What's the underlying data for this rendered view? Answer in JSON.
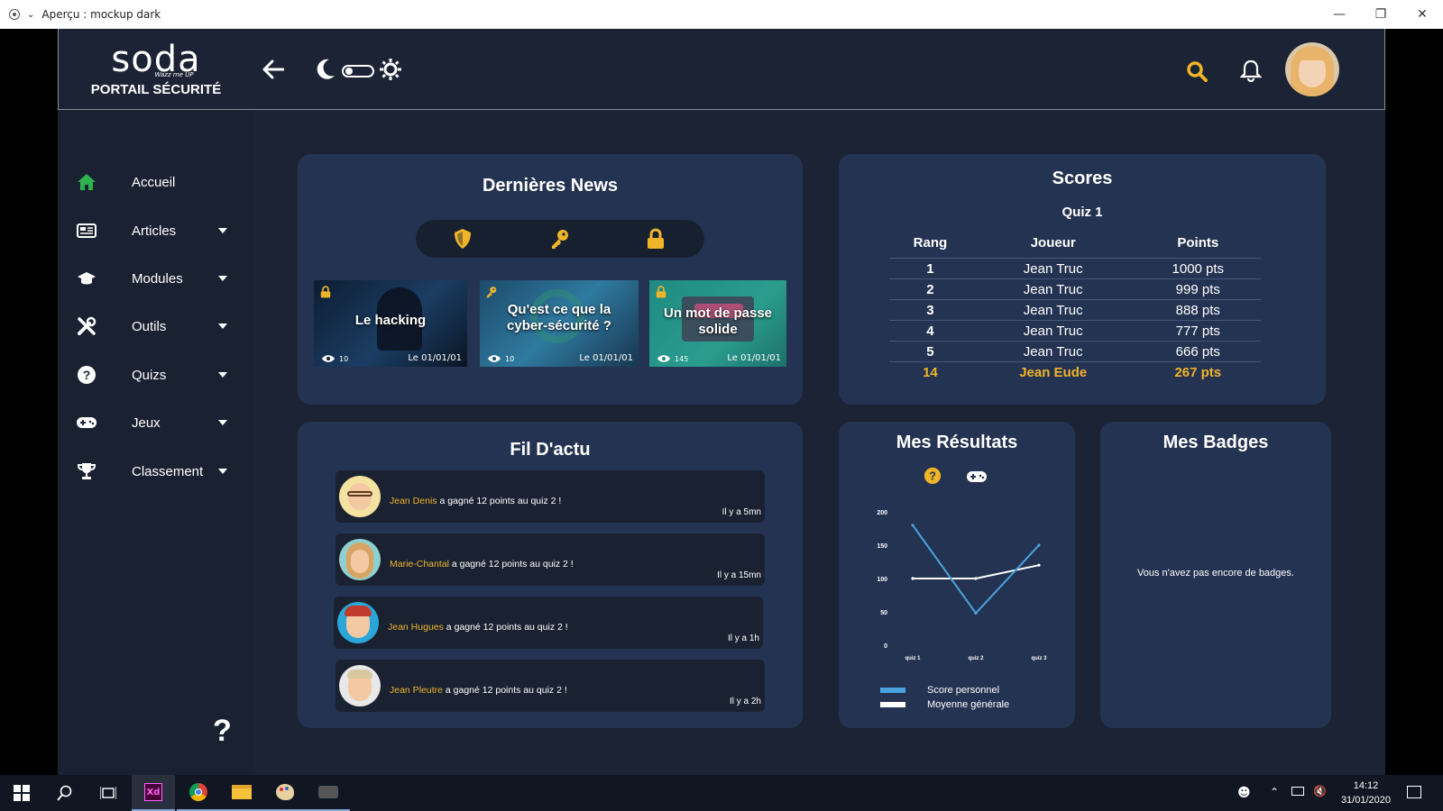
{
  "window": {
    "title": "Aperçu : mockup dark"
  },
  "brand": {
    "logo": "soda",
    "tagline": "Wazz me UP",
    "portal": "PORTAIL SÉCURITÉ"
  },
  "sidebar": {
    "items": [
      {
        "label": "Accueil",
        "icon": "home-icon"
      },
      {
        "label": "Articles",
        "icon": "newspaper-icon"
      },
      {
        "label": "Modules",
        "icon": "graduation-cap-icon"
      },
      {
        "label": "Outils",
        "icon": "tools-icon"
      },
      {
        "label": "Quizs",
        "icon": "question-circle-icon"
      },
      {
        "label": "Jeux",
        "icon": "gamepad-icon"
      },
      {
        "label": "Classement",
        "icon": "trophy-icon"
      }
    ],
    "help": "?"
  },
  "news": {
    "title": "Dernières News",
    "filters": [
      "shield-icon",
      "key-icon",
      "lock-icon"
    ],
    "items": [
      {
        "title": "Le hacking",
        "views": "10",
        "date": "Le 01/01/01",
        "badge": "lock-icon"
      },
      {
        "title": "Qu'est ce que la cyber-sécurité ?",
        "views": "10",
        "date": "Le 01/01/01",
        "badge": "key-icon"
      },
      {
        "title": "Un mot de passe solide",
        "views": "145",
        "date": "Le 01/01/01",
        "badge": "lock-icon"
      }
    ]
  },
  "scores": {
    "title": "Scores",
    "subtitle": "Quiz 1",
    "headers": [
      "Rang",
      "Joueur",
      "Points"
    ],
    "rows": [
      [
        "1",
        "Jean Truc",
        "1000 pts"
      ],
      [
        "2",
        "Jean Truc",
        "999 pts"
      ],
      [
        "3",
        "Jean Truc",
        "888 pts"
      ],
      [
        "4",
        "Jean Truc",
        "777 pts"
      ],
      [
        "5",
        "Jean Truc",
        "666 pts"
      ]
    ],
    "me": [
      "14",
      "Jean Eude",
      "267 pts"
    ]
  },
  "feed": {
    "title": "Fil D'actu",
    "items": [
      {
        "name": "Jean Denis",
        "text": " a gagné 12 points au quiz 2 !",
        "time": "Il y a 5mn"
      },
      {
        "name": "Marie-Chantal",
        "text": " a gagné 12 points au quiz 2 !",
        "time": "Il y a 15mn"
      },
      {
        "name": "Jean Hugues",
        "text": " a gagné 12 points au quiz 2 !",
        "time": "Il y a 1h"
      },
      {
        "name": "Jean Pleutre",
        "text": " a gagné 12 points au quiz 2 !",
        "time": "Il y a 2h"
      }
    ]
  },
  "results": {
    "title": "Mes Résultats",
    "legend": [
      "Score personnel",
      "Moyenne générale"
    ]
  },
  "chart_data": {
    "type": "line",
    "categories": [
      "quiz 1",
      "quiz 2",
      "quiz 3"
    ],
    "yticks": [
      "0",
      "50",
      "100",
      "150",
      "200"
    ],
    "ylim": [
      0,
      200
    ],
    "series": [
      {
        "name": "Score personnel",
        "values": [
          180,
          48,
          150
        ],
        "color": "#4aa3df"
      },
      {
        "name": "Moyenne générale",
        "values": [
          100,
          100,
          120
        ],
        "color": "#ffffff"
      }
    ]
  },
  "badges": {
    "title": "Mes Badges",
    "empty": "Vous n'avez pas encore de badges."
  },
  "taskbar": {
    "time": "14:12",
    "date": "31/01/2020"
  },
  "colors": {
    "accent": "#f0b429",
    "card": "#243351",
    "bg": "#1b2334",
    "green": "#2fb14f"
  }
}
